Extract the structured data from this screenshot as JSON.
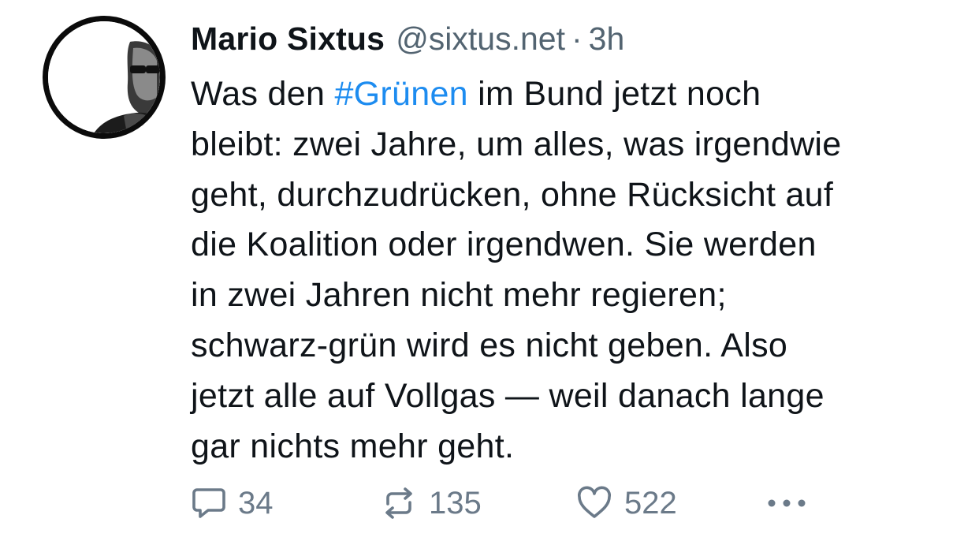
{
  "post": {
    "author": {
      "name": "Mario Sixtus",
      "handle": "@sixtus.net",
      "separator": "·",
      "time": "3h"
    },
    "text_lines": [
      {
        "before": "Was den ",
        "hashtag": "#Grünen",
        "after": " im Bund jetzt noch"
      },
      "bleibt: zwei Jahre, um alles, was irgendwie",
      "geht, durchzudrücken, ohne Rücksicht auf",
      "die Koalition oder irgendwen. Sie werden",
      "in zwei Jahren nicht mehr regieren;",
      "schwarz-grün wird es nicht geben. Also",
      "jetzt alle auf Vollgas — weil danach lange",
      "gar nichts mehr geht."
    ],
    "actions": {
      "replies": "34",
      "reposts": "135",
      "likes": "522"
    }
  },
  "icons": {
    "reply": "speech-bubble-icon",
    "repost": "repost-arrows-icon",
    "like": "heart-icon",
    "more": "more-dots-icon"
  },
  "colors": {
    "text": "#0f1419",
    "secondary": "#536471",
    "hashtag": "#1d8cf0",
    "action_icons": "#6b7a89"
  }
}
